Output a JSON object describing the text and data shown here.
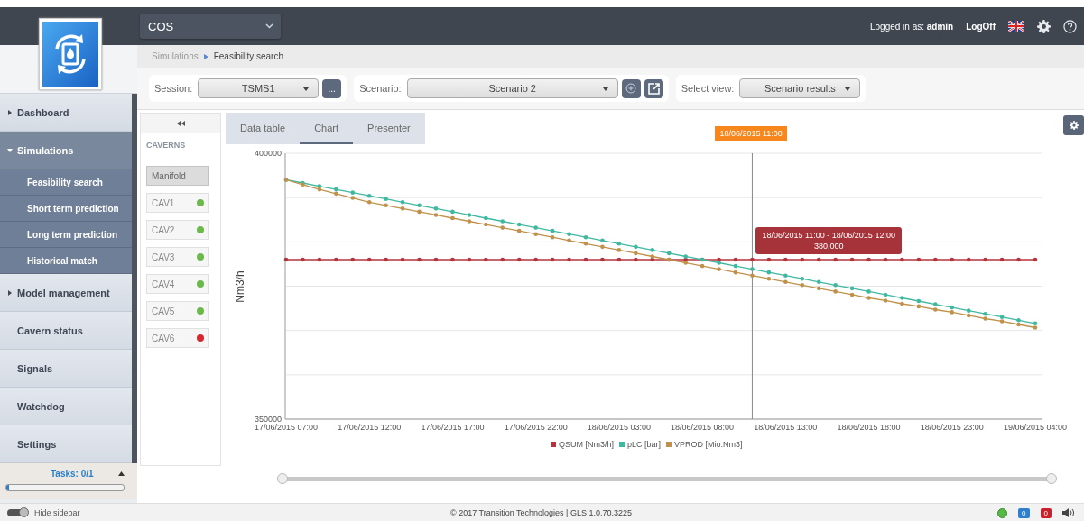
{
  "header": {
    "app_selector": "COS",
    "logged_in": "Logged in as: **admin**",
    "logoff": "LogOff"
  },
  "breadcrumb": [
    "Simulations",
    "Feasibility search"
  ],
  "toolbar": {
    "session": {
      "label": "Session:",
      "value": "TSMS1",
      "more": "..."
    },
    "scenario": {
      "label": "Scenario:",
      "value": "Scenario 2"
    },
    "view": {
      "label": "Select view:",
      "value": "Scenario results"
    }
  },
  "sidebar": {
    "items": [
      {
        "label": "Dashboard",
        "kind": "group",
        "expanded": false
      },
      {
        "label": "Simulations",
        "kind": "group",
        "expanded": true,
        "children": [
          {
            "label": "Feasibility search"
          },
          {
            "label": "Short term prediction"
          },
          {
            "label": "Long term prediction"
          },
          {
            "label": "Historical match"
          }
        ]
      },
      {
        "label": "Model management",
        "kind": "group",
        "expanded": false
      },
      {
        "label": "Cavern status",
        "kind": "link"
      },
      {
        "label": "Signals",
        "kind": "link"
      },
      {
        "label": "Watchdog",
        "kind": "link"
      },
      {
        "label": "Settings",
        "kind": "link"
      }
    ],
    "tasks": {
      "label": "Tasks: 0/1",
      "level": 0.02
    }
  },
  "caverns": {
    "title": "CAVERNS",
    "items": [
      {
        "label": "Manifold",
        "selected": true
      },
      {
        "label": "CAV1",
        "selected": false,
        "color": "#6ab94a"
      },
      {
        "label": "CAV2",
        "selected": false,
        "color": "#6ab94a"
      },
      {
        "label": "CAV3",
        "selected": false,
        "color": "#6ab94a"
      },
      {
        "label": "CAV4",
        "selected": false,
        "color": "#6ab94a"
      },
      {
        "label": "CAV5",
        "selected": false,
        "color": "#6ab94a"
      },
      {
        "label": "CAV6",
        "selected": false,
        "color": "#d9272e"
      }
    ]
  },
  "tabs": [
    {
      "label": "Data table",
      "selected": false
    },
    {
      "label": "Chart",
      "selected": true
    },
    {
      "label": "Presenter",
      "selected": false
    }
  ],
  "chart": {
    "chart_data": {
      "type": "line",
      "ylabel": "Nm3/h",
      "categories": [
        "17/06/2015 07:00",
        null,
        null,
        null,
        null,
        "17/06/2015 12:00",
        null,
        null,
        null,
        null,
        "17/06/2015 17:00",
        null,
        null,
        null,
        null,
        "17/06/2015 22:00",
        null,
        null,
        null,
        null,
        "18/06/2015 03:00",
        null,
        null,
        null,
        null,
        "18/06/2015 08:00",
        null,
        null,
        null,
        null,
        "18/06/2015 13:00",
        null,
        null,
        null,
        null,
        "18/06/2015 18:00",
        null,
        null,
        null,
        null,
        "18/06/2015 23:00",
        null,
        null,
        null,
        null,
        "19/06/2015 04:00"
      ],
      "ylim": [
        350000,
        400000
      ],
      "yticks": [
        350000,
        400000
      ],
      "series": [
        {
          "name": "QSUM [Nm3/h]",
          "color": "#b5343c",
          "values": [
            380000,
            380000,
            380000,
            380000,
            380000,
            380000,
            380000,
            380000,
            380000,
            380000,
            380000,
            380000,
            380000,
            380000,
            380000,
            380000,
            380000,
            380000,
            380000,
            380000,
            380000,
            380000,
            380000,
            380000,
            380000,
            380000,
            380000,
            380000,
            380000,
            380000,
            380000,
            380000,
            380000,
            380000,
            380000,
            380000,
            380000,
            380000,
            380000,
            380000,
            380000,
            380000,
            380000,
            380000,
            380000,
            380000
          ]
        },
        {
          "name": "pLC [bar]",
          "color": "#3fb8a0",
          "values": [
            395000,
            394400,
            393800,
            393200,
            392600,
            392000,
            391400,
            390800,
            390200,
            389600,
            389000,
            388400,
            387800,
            387200,
            386600,
            386000,
            385400,
            384800,
            384200,
            383600,
            383000,
            382400,
            381800,
            381200,
            380600,
            380000,
            379400,
            378800,
            378200,
            377600,
            377000,
            376400,
            375800,
            375200,
            374600,
            374000,
            373400,
            372800,
            372200,
            371600,
            371000,
            370400,
            369800,
            369200,
            368600,
            368000
          ]
        },
        {
          "name": "VPROD [Mio.Nm3]",
          "color": "#c0914a",
          "values": [
            395000,
            394100,
            393200,
            392400,
            391600,
            390800,
            390200,
            389600,
            389000,
            388400,
            387800,
            387200,
            386600,
            386000,
            385400,
            384800,
            384200,
            383600,
            383000,
            382400,
            381800,
            381200,
            380600,
            380000,
            379400,
            378800,
            378200,
            377600,
            377000,
            376400,
            375800,
            375200,
            374600,
            374000,
            373400,
            372800,
            372300,
            371700,
            371200,
            370600,
            370100,
            369500,
            368900,
            368400,
            367800,
            367200
          ]
        }
      ],
      "legend": "bottom",
      "annotations": [
        "18/06/2015 11:00",
        "18/06/2015 11:00 - 18/06/2015 12:00\n380,000"
      ]
    },
    "range_slider": {
      "level": 1
    }
  },
  "footer": {
    "hide_sidebar": "Hide sidebar",
    "hide_sidebar_on": true,
    "copyright": "© 2017 Transition Technologies | GLS 1.0.70.3225",
    "badges": [
      {
        "count": "0",
        "color": "#2f7fd1"
      },
      {
        "count": "0",
        "color": "#c9202a"
      }
    ]
  }
}
